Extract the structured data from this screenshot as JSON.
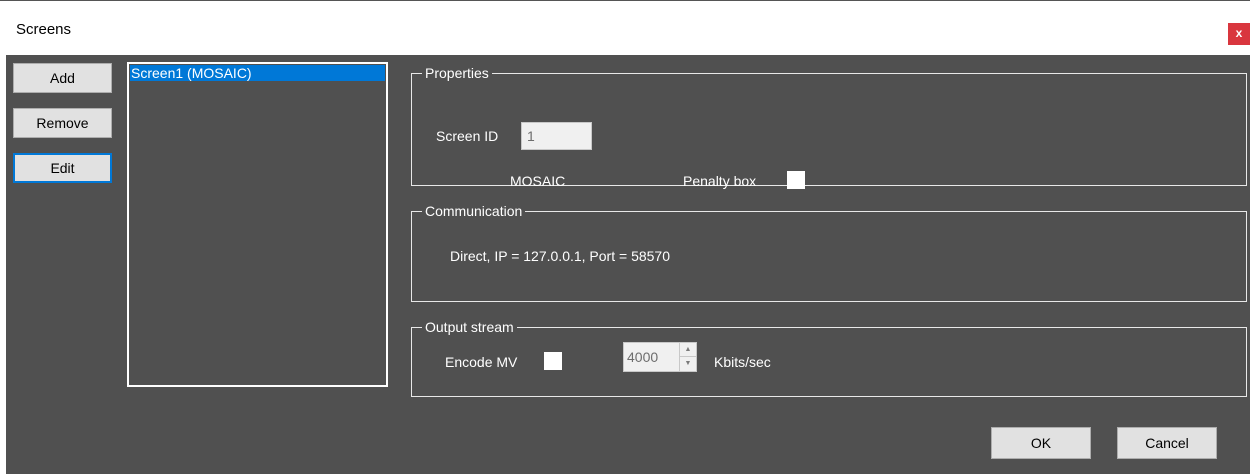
{
  "window": {
    "title": "Screens",
    "close_label": "x"
  },
  "buttons": {
    "add": "Add",
    "remove": "Remove",
    "edit": "Edit",
    "ok": "OK",
    "cancel": "Cancel"
  },
  "screens_list": {
    "items": [
      "Screen1 (MOSAIC)"
    ],
    "selected_index": 0
  },
  "properties": {
    "legend": "Properties",
    "screen_id_label": "Screen ID",
    "screen_id_value": "1",
    "mode_label": "MOSAIC",
    "penalty_box_label": "Penalty box",
    "penalty_box_checked": false
  },
  "communication": {
    "legend": "Communication",
    "text": "Direct, IP = 127.0.0.1, Port = 58570"
  },
  "output_stream": {
    "legend": "Output stream",
    "encode_mv_label": "Encode MV",
    "encode_mv_checked": false,
    "bitrate_value": "4000",
    "bitrate_unit": "Kbits/sec"
  },
  "colors": {
    "background": "#505050",
    "accent": "#0078d7",
    "close": "#d9363e"
  }
}
